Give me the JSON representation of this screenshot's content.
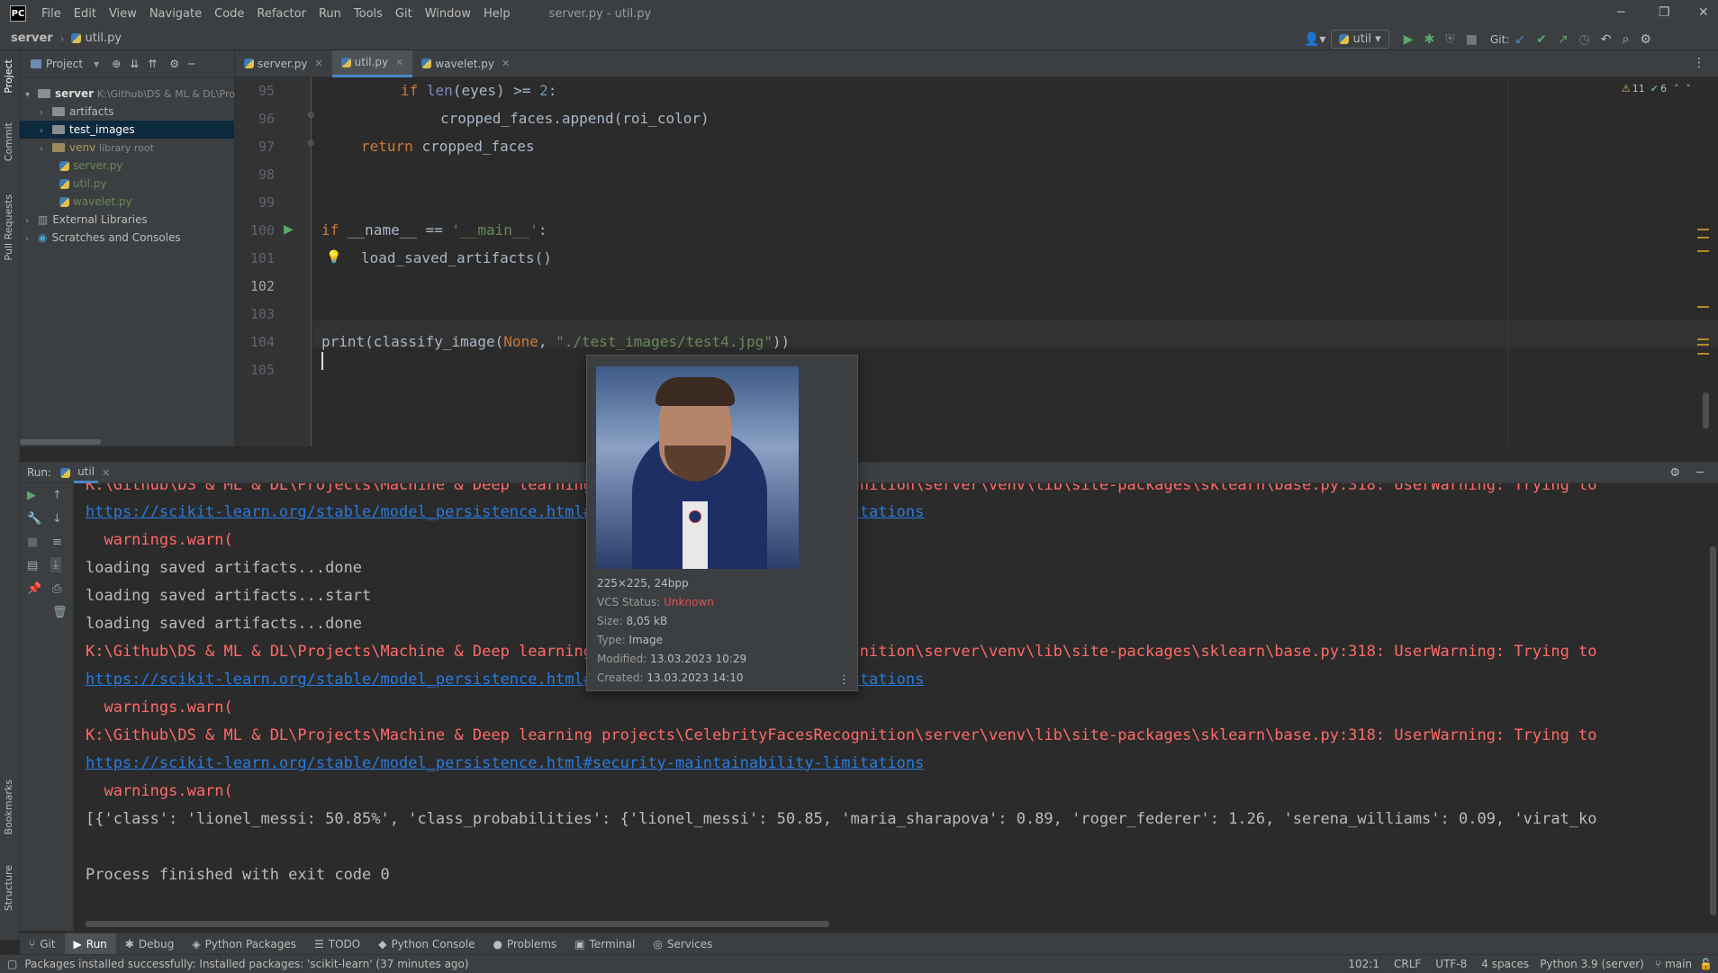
{
  "window": {
    "logo": "PC",
    "menu": [
      "File",
      "Edit",
      "View",
      "Navigate",
      "Code",
      "Refactor",
      "Run",
      "Tools",
      "Git",
      "Window",
      "Help"
    ],
    "title": "server.py - util.py"
  },
  "navbar": {
    "project": "server",
    "file": "util.py",
    "run_config": "util",
    "git_label": "Git:"
  },
  "project_panel": {
    "title": "Project",
    "tree": [
      {
        "label": "server",
        "extra": "K:\\Github\\DS & ML & DL\\Pro",
        "type": "folder-root"
      },
      {
        "label": "artifacts",
        "type": "folder"
      },
      {
        "label": "test_images",
        "type": "folder"
      },
      {
        "label": "venv",
        "extra": "library root",
        "type": "folder"
      },
      {
        "label": "server.py",
        "type": "file"
      },
      {
        "label": "util.py",
        "type": "file"
      },
      {
        "label": "wavelet.py",
        "type": "file"
      },
      {
        "label": "External Libraries",
        "type": "lib"
      },
      {
        "label": "Scratches and Consoles",
        "type": "scratch"
      }
    ]
  },
  "left_tools": [
    "Project",
    "Commit",
    "Pull Requests",
    "Bookmarks",
    "Structure"
  ],
  "editor": {
    "tabs": [
      "server.py",
      "util.py",
      "wavelet.py"
    ],
    "inspections": {
      "warnings": "11",
      "ok": "6"
    },
    "line_numbers": [
      "95",
      "96",
      "97",
      "98",
      "99",
      "100",
      "101",
      "102",
      "103",
      "104",
      "105"
    ],
    "code": {
      "l95_a": "if ",
      "l95_b": "len",
      "l95_c": "(eyes) >= ",
      "l95_d": "2",
      "l95_e": ":",
      "l96": "cropped_faces.append(roi_color)",
      "l97_a": "return ",
      "l97_b": "cropped_faces",
      "l100_a": "if ",
      "l100_b": "__name__",
      "l100_c": " == ",
      "l100_d": "'__main__'",
      "l100_e": ":",
      "l101": "load_saved_artifacts()",
      "l104_a": "print(classify_image(",
      "l104_b": "None",
      "l104_c": ", ",
      "l104_d": "\"./test_images/test4.jpg\"",
      "l104_e": "))"
    }
  },
  "run_panel": {
    "label": "Run:",
    "config": "util",
    "lines": [
      {
        "text": "K:\\Github\\DS & ML & DL\\Projects\\Machine & Deep learning projects\\CelebrityFacesRecognition\\server\\venv\\lib\\site-packages\\sklearn\\base.py:318: UserWarning: Trying to",
        "type": "err"
      },
      {
        "text": "https://scikit-learn.org/stable/model_persistence.html#security-maintainability-limitations",
        "type": "link"
      },
      {
        "text": "  warnings.warn(",
        "type": "err"
      },
      {
        "text": "loading saved artifacts...done",
        "type": "out"
      },
      {
        "text": "loading saved artifacts...start",
        "type": "out"
      },
      {
        "text": "loading saved artifacts...done",
        "type": "out"
      },
      {
        "text": "K:\\Github\\DS & ML & DL\\Projects\\Machine & Deep learning projects\\CelebrityFacesRecognition\\server\\venv\\lib\\site-packages\\sklearn\\base.py:318: UserWarning: Trying to",
        "type": "err"
      },
      {
        "text": "https://scikit-learn.org/stable/model_persistence.html#security-maintainability-limitations",
        "type": "link"
      },
      {
        "text": "  warnings.warn(",
        "type": "err"
      },
      {
        "text": "K:\\Github\\DS & ML & DL\\Projects\\Machine & Deep learning projects\\CelebrityFacesRecognition\\server\\venv\\lib\\site-packages\\sklearn\\base.py:318: UserWarning: Trying to",
        "type": "err"
      },
      {
        "text": "https://scikit-learn.org/stable/model_persistence.html#security-maintainability-limitations",
        "type": "link"
      },
      {
        "text": "  warnings.warn(",
        "type": "err"
      },
      {
        "text": "[{'class': 'lionel_messi: 50.85%', 'class_probabilities': {'lionel_messi': 50.85, 'maria_sharapova': 0.89, 'roger_federer': 1.26, 'serena_williams': 0.09, 'virat_ko",
        "type": "out"
      },
      {
        "text": "",
        "type": "out"
      },
      {
        "text": "Process finished with exit code 0",
        "type": "out"
      }
    ]
  },
  "image_popup": {
    "dims": "225×225, 24bpp",
    "vcs_label": "VCS Status: ",
    "vcs_value": "Unknown",
    "size_label": "Size: ",
    "size_value": "8,05 kB",
    "type_label": "Type: ",
    "type_value": "Image",
    "modified_label": "Modified: ",
    "modified_value": "13.03.2023 10:29",
    "created_label": "Created: ",
    "created_value": "13.03.2023 14:10"
  },
  "bottom_tabs": [
    "Git",
    "Run",
    "Debug",
    "Python Packages",
    "TODO",
    "Python Console",
    "Problems",
    "Terminal",
    "Services"
  ],
  "status": {
    "message": "Packages installed successfully: Installed packages: 'scikit-learn' (37 minutes ago)",
    "position": "102:1",
    "line_sep": "CRLF",
    "encoding": "UTF-8",
    "indent": "4 spaces",
    "interpreter": "Python 3.9 (server)",
    "branch": "main"
  },
  "colors": {
    "accent": "#4a88c7",
    "error": "#ff6b68",
    "link": "#287bde",
    "keyword": "#cc7832"
  }
}
